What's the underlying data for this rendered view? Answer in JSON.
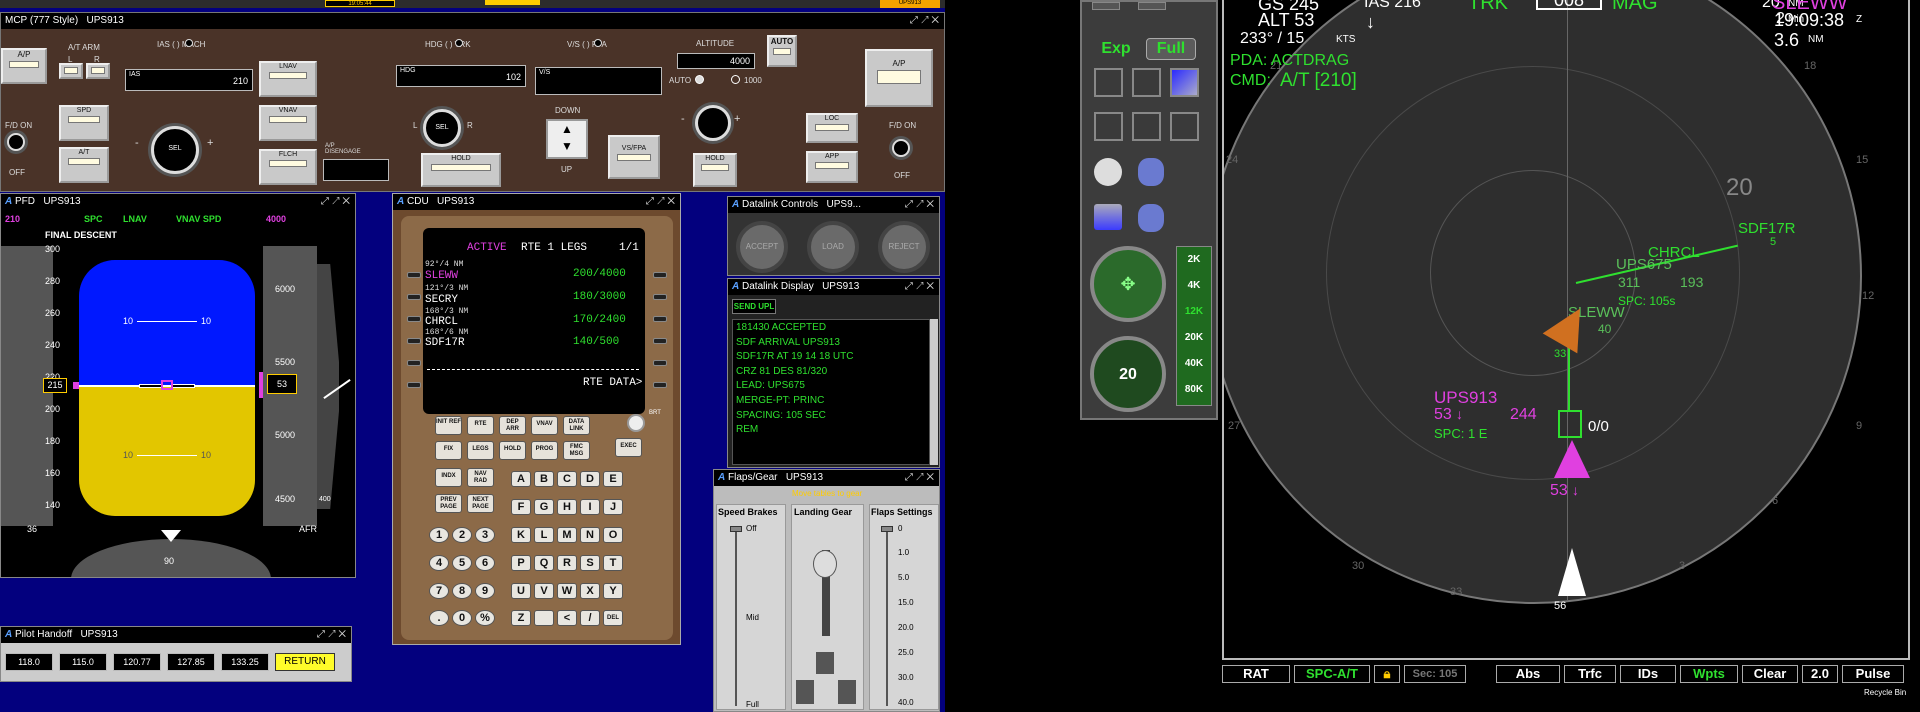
{
  "top_strip": {
    "time": "19:05:44",
    "right_field": "UPS913"
  },
  "mcp": {
    "title": "MCP (777 Style)",
    "callsign": "UPS913",
    "ap_label": "A/P",
    "at_arm": "A/T ARM",
    "at_l": "L",
    "at_r": "R",
    "fd_on": "F/D ON",
    "off": "OFF",
    "spd_label": "SPD",
    "at_label": "A/T",
    "ias_mach": "IAS (     ) MACH",
    "ias_box_label": "IAS",
    "ias_value": "210",
    "sel": "SEL",
    "minus": "-",
    "plus": "+",
    "lnav": "LNAV",
    "vnav": "VNAV",
    "flch": "FLCH",
    "ap_disengage": "A/P DISENGAGE",
    "hdg_trk": "HDG (     ) TRK",
    "hdg_box_label": "HDG",
    "hdg_value": "102",
    "knob_l": "L",
    "knob_r": "R",
    "hold": "HOLD",
    "vs_fpa": "V/S (     ) FPA",
    "vs_box_label": "V/S",
    "vs_value": "",
    "down": "DOWN",
    "up": "UP",
    "vs_fpa_btn": "VS/FPA",
    "altitude_label": "ALTITUDE",
    "altitude_value": "4000",
    "auto_btn": "AUTO",
    "auto_sel": "AUTO",
    "alt_1000": "1000",
    "loc": "LOC",
    "app": "APP",
    "alt_hold": "HOLD"
  },
  "pfd": {
    "title": "PFD",
    "callsign": "UPS913",
    "fma": [
      "210",
      "SPC",
      "LNAV",
      "VNAV SPD",
      "4000"
    ],
    "mode": "FINAL DESCENT",
    "speed_ticks": [
      "300",
      "280",
      "260",
      "240",
      "220",
      "200",
      "180",
      "160",
      "140"
    ],
    "speed_value": "215",
    "speed_bottom": "36",
    "alt_ticks": [
      "6000",
      "5500",
      "5000",
      "4500"
    ],
    "alt_value": "53",
    "alt_bottom": "AFR",
    "vs_bottom": "400",
    "pitch": [
      "10",
      "10",
      "10",
      "10"
    ],
    "heading": "90"
  },
  "cdu": {
    "title": "CDU",
    "callsign": "UPS913",
    "header": "ACTIVE",
    "header_rest": "RTE 1 LEGS",
    "page": "1/1",
    "legs": [
      {
        "course": "92°/4 NM",
        "name": "SLEWW",
        "constraint": "200/4000"
      },
      {
        "course": "121°/3 NM",
        "name": "SECRY",
        "constraint": "180/3000"
      },
      {
        "course": "168°/3 NM",
        "name": "CHRCL",
        "constraint": "170/2400"
      },
      {
        "course": "168°/6 NM",
        "name": "SDF17R",
        "constraint": "140/500"
      }
    ],
    "rte_data": "RTE DATA>",
    "fkeys_row1": [
      "INIT REF",
      "RTE",
      "DEP ARR",
      "VNAV",
      "DATA LINK"
    ],
    "fkeys_row2": [
      "FIX",
      "LEGS",
      "HOLD",
      "PROG",
      "FMC MSG"
    ],
    "fkeys_row3": [
      "INDX",
      "NAV RAD"
    ],
    "fkeys_row4": [
      "PREV PAGE",
      "NEXT PAGE"
    ],
    "brt": "BRT",
    "exec": "EXEC",
    "letters": [
      "A",
      "B",
      "C",
      "D",
      "E",
      "F",
      "G",
      "H",
      "I",
      "J",
      "K",
      "L",
      "M",
      "N",
      "O",
      "P",
      "Q",
      "R",
      "S",
      "T",
      "U",
      "V",
      "W",
      "X",
      "Y",
      "Z",
      "",
      "<",
      "/",
      "DEL"
    ],
    "digits": [
      "1",
      "2",
      "3",
      "4",
      "5",
      "6",
      "7",
      "8",
      "9",
      ".",
      "0",
      "%"
    ]
  },
  "dl_controls": {
    "title": "Datalink Controls",
    "callsign": "UPS9...",
    "buttons": [
      "ACCEPT",
      "LOAD",
      "REJECT"
    ]
  },
  "dl_display": {
    "title": "Datalink Display",
    "callsign": "UPS913",
    "send_btn": "SEND UPL",
    "lines": [
      "181430        ACCEPTED",
      "SDF ARRIVAL UPS913",
      "SDF17R AT 19 14 18 UTC",
      "CRZ 81  DES 81/320",
      "LEAD: UPS675",
      " MERGE-PT: PRINC",
      " SPACING: 105 SEC",
      "REM"
    ]
  },
  "flaps": {
    "title": "Flaps/Gear",
    "callsign": "UPS913",
    "warning": "Move tables to gear",
    "speed_brakes": "Speed Brakes",
    "landing_gear": "Landing Gear",
    "flaps_settings": "Flaps Settings",
    "sb_marks": [
      "Off",
      "Mid",
      "Full"
    ],
    "flap_marks": [
      "0",
      "1.0",
      "5.0",
      "15.0",
      "20.0",
      "25.0",
      "30.0",
      "40.0"
    ]
  },
  "handoff": {
    "title": "Pilot Handoff",
    "callsign": "UPS913",
    "freqs": [
      "118.0",
      "115.0",
      "120.77",
      "127.85",
      "133.25"
    ],
    "return_btn": "RETURN"
  },
  "palette": {
    "exp": "Exp",
    "full": "Full",
    "alt_filters": [
      "2K",
      "4K",
      "12K",
      "20K",
      "40K",
      "80K"
    ],
    "range": "20"
  },
  "nd": {
    "gs": "GS 245",
    "ias": "IAS 216",
    "trk": "TRK",
    "trk_box": "008",
    "mag": "MAG",
    "nm_val": "20",
    "nm_unit": "NM",
    "leader": "SLEWW",
    "alt": "ALT 53",
    "min_val": "2",
    "min_unit": "Min",
    "time": "19:09:38",
    "time_z": "Z",
    "wind": "233° /  15",
    "wind_unit": "KTS",
    "dist": "3.6",
    "dist_unit": "NM",
    "pda": "PDA: ACTDRAG",
    "cmd_label": "CMD:",
    "cmd_value": "A/T [210]",
    "range_label": "20",
    "waypoints": {
      "sdf": "SDF17R",
      "sdf_n": "5",
      "chrcl": "CHRCL",
      "ups675": "UPS675",
      "s311": "311",
      "v193": "193",
      "spc105": "SPC: 105s",
      "sleww": "SLEWW",
      "n40": "40",
      "n33": "33"
    },
    "own": {
      "cs": "UPS913",
      "alt": "53",
      "spd": "244",
      "spc": "SPC: 1 E",
      "box": "0/0",
      "below": "53"
    },
    "bottom_alt": "56",
    "ticks": {
      "t0": "0",
      "t3": "3",
      "t6": "6",
      "t9": "9",
      "t12": "12",
      "t15": "15",
      "t18": "18",
      "t21": "21",
      "t24": "24",
      "t27": "27",
      "t30": "30",
      "t33": "33"
    }
  },
  "statusbar": {
    "rat": "RAT",
    "spc": "SPC-A/T",
    "sec": "Sec: 105",
    "abs": "Abs",
    "trfc": "Trfc",
    "ids": "IDs",
    "wpts": "Wpts",
    "clear": "Clear",
    "zoom": "2.0",
    "pulse": "Pulse"
  },
  "desktop": {
    "recycle": "Recycle Bin"
  },
  "colors": {
    "desktop": "#03007e",
    "mcp": "#4a3328",
    "green": "#2fe02f",
    "magenta": "#e040e0",
    "sky": "#0018ff",
    "ground": "#e2c600"
  }
}
